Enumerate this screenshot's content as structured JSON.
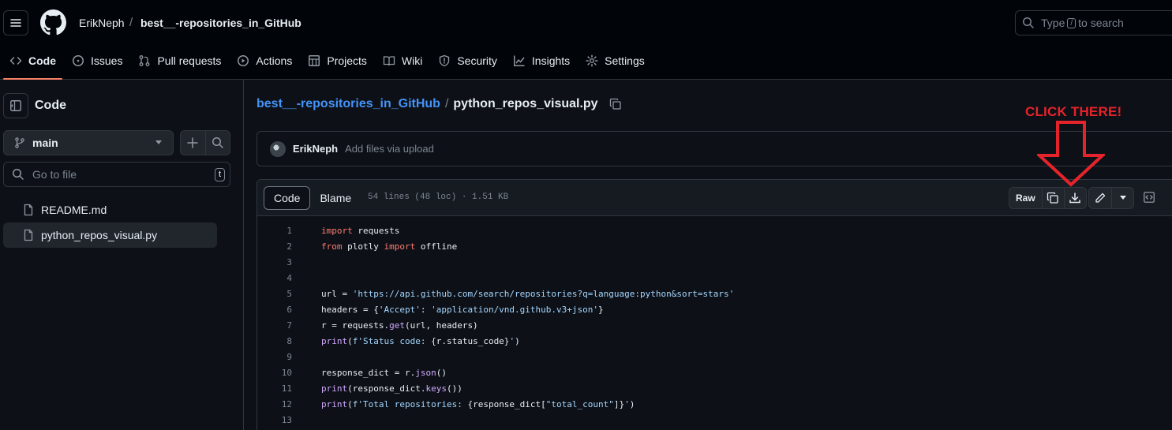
{
  "header": {
    "owner": "ErikNeph",
    "separator": "/",
    "repo": "best__-repositories_in_GitHub",
    "search_prefix": "Type",
    "search_key": "/",
    "search_suffix": "to search"
  },
  "tabs": [
    {
      "label": "Code",
      "icon": "code-icon"
    },
    {
      "label": "Issues",
      "icon": "issue-icon"
    },
    {
      "label": "Pull requests",
      "icon": "pull-request-icon"
    },
    {
      "label": "Actions",
      "icon": "play-icon"
    },
    {
      "label": "Projects",
      "icon": "table-icon"
    },
    {
      "label": "Wiki",
      "icon": "book-icon"
    },
    {
      "label": "Security",
      "icon": "shield-icon"
    },
    {
      "label": "Insights",
      "icon": "graph-icon"
    },
    {
      "label": "Settings",
      "icon": "gear-icon"
    }
  ],
  "sidebar": {
    "title": "Code",
    "branch": "main",
    "goto_placeholder": "Go to file",
    "goto_key": "t",
    "files": [
      "README.md",
      "python_repos_visual.py"
    ]
  },
  "main": {
    "path_repo": "best__-repositories_in_GitHub",
    "path_sep": "/",
    "path_file": "python_repos_visual.py",
    "commit_author": "ErikNeph",
    "commit_message": "Add files via upload",
    "view_code": "Code",
    "view_blame": "Blame",
    "file_meta": "54 lines (48 loc) · 1.51 KB",
    "raw_label": "Raw"
  },
  "code_lines": [
    [
      {
        "t": "kw",
        "v": "import"
      },
      {
        "t": "",
        "v": " requests"
      }
    ],
    [
      {
        "t": "kw",
        "v": "from"
      },
      {
        "t": "",
        "v": " plotly "
      },
      {
        "t": "kw",
        "v": "import"
      },
      {
        "t": "",
        "v": " offline"
      }
    ],
    [],
    [],
    [
      {
        "t": "",
        "v": "url = "
      },
      {
        "t": "str",
        "v": "'https://api.github.com/search/repositories?q=language:python&sort=stars'"
      }
    ],
    [
      {
        "t": "",
        "v": "headers = {"
      },
      {
        "t": "str",
        "v": "'Accept'"
      },
      {
        "t": "",
        "v": ": "
      },
      {
        "t": "str",
        "v": "'application/vnd.github.v3+json'"
      },
      {
        "t": "",
        "v": "}"
      }
    ],
    [
      {
        "t": "",
        "v": "r = requests."
      },
      {
        "t": "fn",
        "v": "get"
      },
      {
        "t": "",
        "v": "(url, headers)"
      }
    ],
    [
      {
        "t": "fn",
        "v": "print"
      },
      {
        "t": "",
        "v": "("
      },
      {
        "t": "str",
        "v": "f'Status code: "
      },
      {
        "t": "",
        "v": "{r.status_code}"
      },
      {
        "t": "str",
        "v": "'"
      },
      {
        "t": "",
        "v": ")"
      }
    ],
    [],
    [
      {
        "t": "",
        "v": "response_dict = r."
      },
      {
        "t": "fn",
        "v": "json"
      },
      {
        "t": "",
        "v": "()"
      }
    ],
    [
      {
        "t": "fn",
        "v": "print"
      },
      {
        "t": "",
        "v": "(response_dict."
      },
      {
        "t": "fn",
        "v": "keys"
      },
      {
        "t": "",
        "v": "())"
      }
    ],
    [
      {
        "t": "fn",
        "v": "print"
      },
      {
        "t": "",
        "v": "("
      },
      {
        "t": "str",
        "v": "f'Total repositories: "
      },
      {
        "t": "",
        "v": "{response_dict["
      },
      {
        "t": "str",
        "v": "\"total_count\""
      },
      {
        "t": "",
        "v": "]}"
      },
      {
        "t": "str",
        "v": "'"
      },
      {
        "t": "",
        "v": ")"
      }
    ],
    []
  ],
  "annotation": {
    "text": "CLICK THERE!",
    "color": "#e5232b"
  }
}
